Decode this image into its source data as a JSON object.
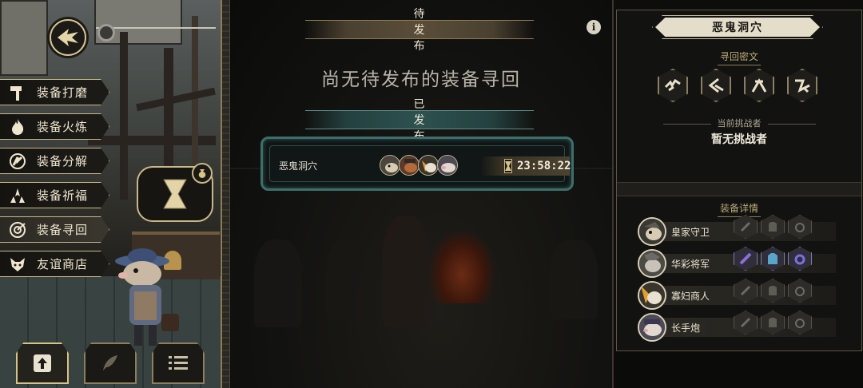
{
  "left": {
    "menu": [
      {
        "label": "装备打磨",
        "icon": "hammer-icon",
        "active": false
      },
      {
        "label": "装备火炼",
        "icon": "flame-icon",
        "active": false
      },
      {
        "label": "装备分解",
        "icon": "disassemble-icon",
        "active": false
      },
      {
        "label": "装备祈福",
        "icon": "altar-icon",
        "active": false
      },
      {
        "label": "装备寻回",
        "icon": "target-icon",
        "active": true
      },
      {
        "label": "友谊商店",
        "icon": "fox-mask-icon",
        "active": false
      }
    ],
    "bottom_buttons": [
      "upload-icon",
      "feather-icon",
      "list-icon"
    ]
  },
  "center": {
    "pending_banner": "待发布",
    "pending_empty": "尚无待发布的装备寻回",
    "published_banner": "已发布",
    "info_icon": "i",
    "published_entries": [
      {
        "name": "恶鬼洞穴",
        "timer": "23:58:22",
        "avatars": [
          "royal-guard",
          "fancy-general",
          "widow-merchant",
          "long-gun"
        ]
      }
    ]
  },
  "right": {
    "dungeon_title": "恶鬼洞穴",
    "rune_label": "寻回密文",
    "runes": [
      "rune-1-icon",
      "rune-2-icon",
      "rune-3-icon",
      "rune-4-icon"
    ],
    "challenger_label": "当前挑战者",
    "challenger_value": "暂无挑战者",
    "equip_label": "装备详情",
    "equipment": [
      {
        "name": "皇家守卫",
        "lit": false
      },
      {
        "name": "华彩将军",
        "lit": true
      },
      {
        "name": "寡妇商人",
        "lit": false
      },
      {
        "name": "长手炮",
        "lit": false
      }
    ]
  },
  "colors": {
    "gold": "#c9b88a",
    "teal": "#3d6e6a",
    "lit_purple": "#7d7aa8",
    "lit_blue": "#5aa3c9"
  }
}
